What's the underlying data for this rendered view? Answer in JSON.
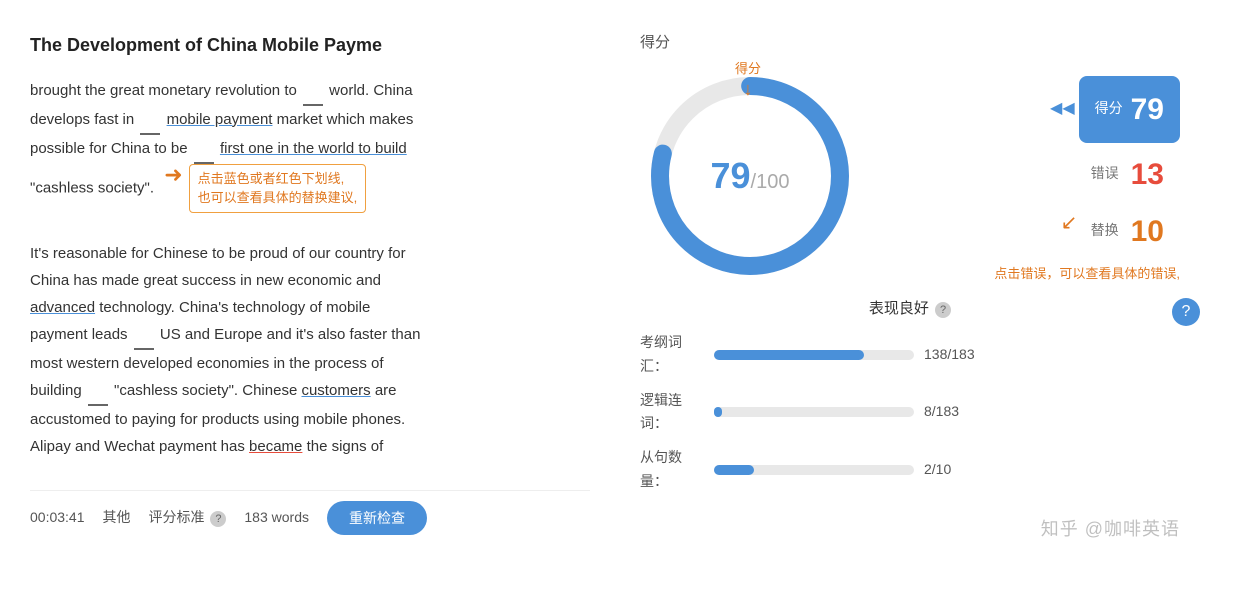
{
  "article": {
    "title": "The Development of China Mobile Payme",
    "paragraphs": [
      "brought the great monetary revolution to   world. China develops fast in   mobile payment market which makes possible for China to be   first one in the world to build \"cashless society\".",
      "It's reasonable for Chinese to be proud of our country for China has made great success in new economic and advanced technology. China's technology of mobile payment leads   US and Europe and it's also faster than most western developed economies in the process of building   \"cashless society\". Chinese customers are accustomed to paying for products using mobile phones. Alipay and Wechat payment has became the signs of"
    ],
    "tooltip1": "点击蓝色或者红色下划线,",
    "tooltip2": "也可以查看具体的替换建议,"
  },
  "bottomBar": {
    "time": "00:03:41",
    "category": "其他",
    "ratingLabel": "评分标准",
    "wordCount": "183 words",
    "recheckLabel": "重新检查"
  },
  "scorePanel": {
    "title": "得分",
    "scoreTooltip": "得分",
    "errorHint": "点击错误，可以查看具体的错误,",
    "mainScore": "79",
    "maxScore": "100",
    "cards": [
      {
        "label": "得分",
        "value": "79",
        "color": "blue",
        "highlight": true
      },
      {
        "label": "错误",
        "value": "13",
        "color": "red"
      },
      {
        "label": "替换",
        "value": "10",
        "color": "orange"
      }
    ],
    "performanceTitle": "表现良好",
    "stats": [
      {
        "name": "考纲词汇：",
        "filled": 75,
        "count": "138/183"
      },
      {
        "name": "逻辑连词：",
        "filled": 4,
        "count": "8/183"
      },
      {
        "name": "从句数量：",
        "filled": 20,
        "count": "2/10"
      }
    ]
  },
  "watermark": "知乎 @咖啡英语",
  "icons": {
    "chevronLeft": "◀◀",
    "question": "?",
    "questionBadge": "?"
  }
}
